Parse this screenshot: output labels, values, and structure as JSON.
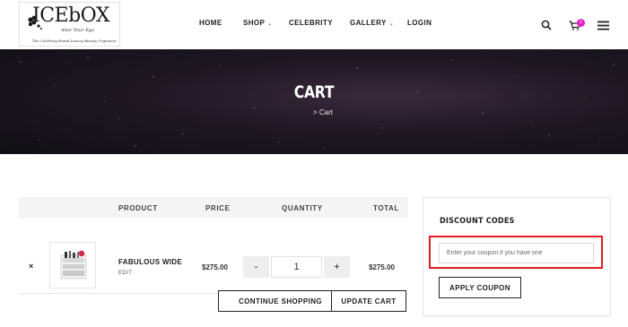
{
  "logo": {
    "brand": "ICEbOX",
    "tagline": "Alter Your Ego",
    "subtagline": "The Celebrity Brand Luxury Beauty Organizer"
  },
  "nav": {
    "items": [
      {
        "label": "HOME",
        "has_dropdown": false
      },
      {
        "label": "SHOP",
        "has_dropdown": true
      },
      {
        "label": "CELEBRITY",
        "has_dropdown": false
      },
      {
        "label": "GALLERY",
        "has_dropdown": true
      },
      {
        "label": "LOGIN",
        "has_dropdown": false
      }
    ],
    "icons": [
      "search-icon",
      "cart-icon",
      "menu-icon"
    ],
    "cart_count": "1",
    "badge_color": "#e91ec7"
  },
  "banner": {
    "title": "CART",
    "breadcrumb": "> Cart"
  },
  "cart": {
    "headers": {
      "product": "PRODUCT",
      "price": "PRICE",
      "quantity": "QUANTITY",
      "total": "TOTAL"
    },
    "items": [
      {
        "remove": "×",
        "name": "FABULOUS WIDE",
        "edit": "EDIT",
        "price": "$275.00",
        "quantity": "1",
        "total": "$275.00"
      }
    ],
    "minus": "-",
    "plus": "+",
    "continue_label": "CONTINUE SHOPPING",
    "update_label": "UPDATE CART"
  },
  "discount": {
    "title": "DISCOUNT CODES",
    "placeholder": "Enter your coupon if you have one",
    "apply_label": "APPLY COUPON",
    "highlight_color": "#e01e24"
  }
}
